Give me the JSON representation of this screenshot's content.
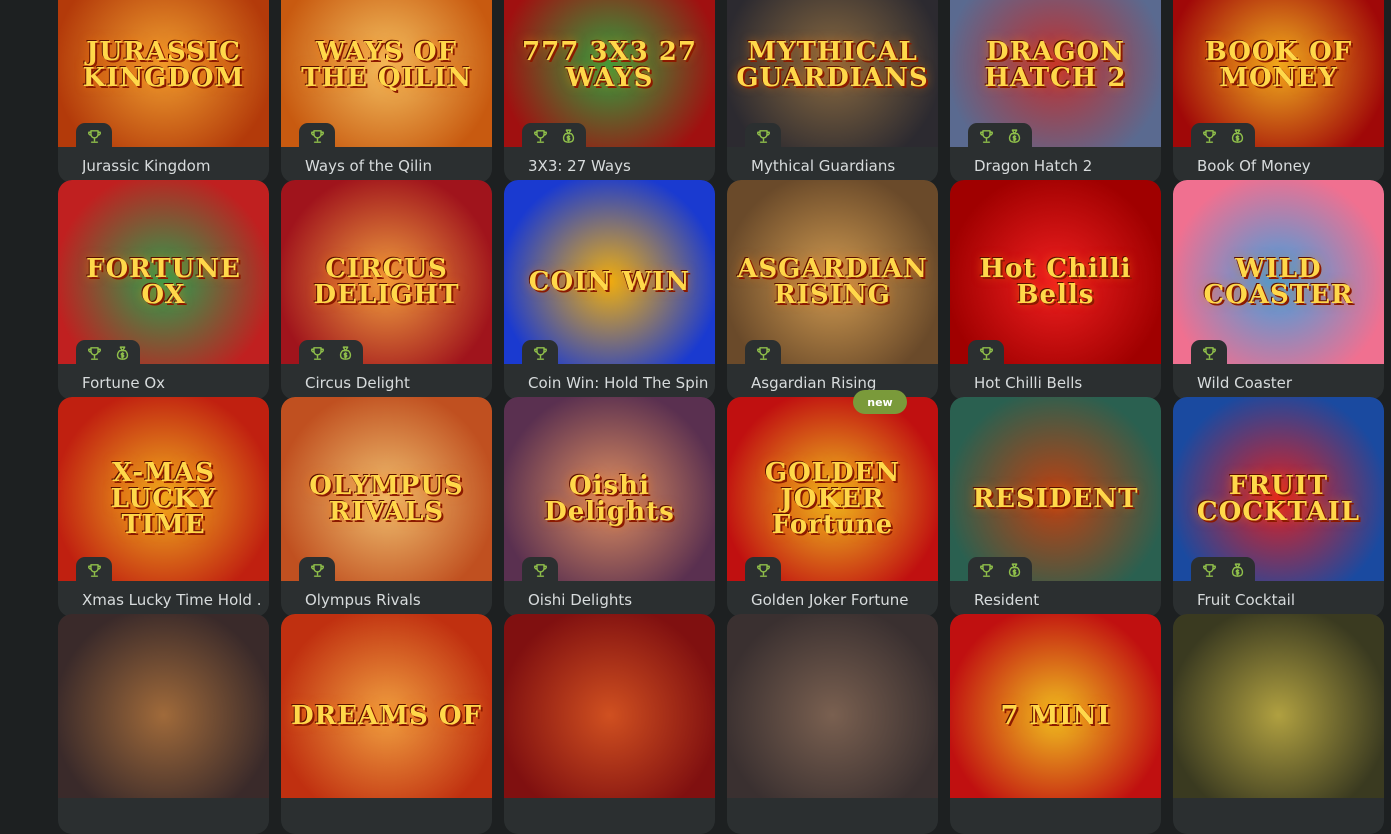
{
  "games": [
    {
      "title": "Jurassic Kingdom",
      "art_text": "JURASSIC KINGDOM",
      "badges": [
        "trophy"
      ],
      "bg": [
        "#b33a0a",
        "#f0a030"
      ]
    },
    {
      "title": "Ways of the Qilin",
      "art_text": "WAYS OF THE QILIN",
      "badges": [
        "trophy"
      ],
      "bg": [
        "#c85a10",
        "#f4c060"
      ]
    },
    {
      "title": "3X3: 27 Ways",
      "art_text": "777 3X3 27 WAYS",
      "badges": [
        "trophy",
        "money-bag"
      ],
      "bg": [
        "#a01010",
        "#30a040"
      ]
    },
    {
      "title": "Mythical Guardians",
      "art_text": "MYTHICAL GUARDIANS",
      "badges": [
        "trophy"
      ],
      "bg": [
        "#2c2a30",
        "#8a6a40"
      ]
    },
    {
      "title": "Dragon Hatch 2",
      "art_text": "DRAGON HATCH 2",
      "badges": [
        "trophy",
        "money-bag"
      ],
      "bg": [
        "#5a6a90",
        "#c03030"
      ]
    },
    {
      "title": "Book Of Money",
      "art_text": "BOOK OF MONEY",
      "badges": [
        "trophy",
        "money-bag"
      ],
      "bg": [
        "#a00808",
        "#f0b020"
      ]
    },
    {
      "title": "Fortune Ox",
      "art_text": "FORTUNE OX",
      "badges": [
        "trophy",
        "money-bag"
      ],
      "bg": [
        "#c02020",
        "#2aa050"
      ]
    },
    {
      "title": "Circus Delight",
      "art_text": "CIRCUS DELIGHT",
      "badges": [
        "trophy",
        "money-bag"
      ],
      "bg": [
        "#a0141c",
        "#f0a040"
      ]
    },
    {
      "title": "Coin Win: Hold The Spin",
      "art_text": "COIN WIN",
      "badges": [
        "trophy"
      ],
      "bg": [
        "#1a3ad0",
        "#f0b010"
      ]
    },
    {
      "title": "Asgardian Rising",
      "art_text": "ASGARDIAN RISING",
      "badges": [
        "trophy"
      ],
      "bg": [
        "#6a4a2a",
        "#d09a50"
      ]
    },
    {
      "title": "Hot Chilli Bells",
      "art_text": "Hot Chilli Bells",
      "badges": [
        "trophy"
      ],
      "bg": [
        "#a00000",
        "#f02020"
      ]
    },
    {
      "title": "Wild Coaster",
      "art_text": "WILD COASTER",
      "badges": [
        "trophy"
      ],
      "bg": [
        "#f07090",
        "#40a0e0"
      ]
    },
    {
      "title": "Xmas Lucky Time Hold ...",
      "art_text": "X-MAS LUCKY TIME",
      "badges": [
        "trophy"
      ],
      "bg": [
        "#c02010",
        "#f0b020"
      ]
    },
    {
      "title": "Olympus Rivals",
      "art_text": "OLYMPUS RIVALS",
      "badges": [
        "trophy"
      ],
      "bg": [
        "#c05020",
        "#f0c070"
      ]
    },
    {
      "title": "Oishi Delights",
      "art_text": "Oishi Delights",
      "badges": [
        "trophy"
      ],
      "bg": [
        "#5a3050",
        "#e09060"
      ]
    },
    {
      "title": "Golden Joker Fortune",
      "art_text": "GOLDEN JOKER Fortune",
      "badges": [
        "trophy"
      ],
      "bg": [
        "#c01010",
        "#f0c020"
      ],
      "new": "new"
    },
    {
      "title": "Resident",
      "art_text": "RESIDENT",
      "badges": [
        "trophy",
        "money-bag"
      ],
      "bg": [
        "#2a6050",
        "#c04010"
      ]
    },
    {
      "title": "Fruit Cocktail",
      "art_text": "FRUIT COCKTAIL",
      "badges": [
        "trophy",
        "money-bag"
      ],
      "bg": [
        "#1a4aa0",
        "#e02020"
      ]
    },
    {
      "title": "",
      "art_text": "",
      "badges": [],
      "bg": [
        "#3a2a2a",
        "#a06a3a"
      ]
    },
    {
      "title": "",
      "art_text": "DREAMS OF",
      "badges": [],
      "bg": [
        "#c03010",
        "#f0a040"
      ]
    },
    {
      "title": "",
      "art_text": "",
      "badges": [],
      "bg": [
        "#801010",
        "#d05020"
      ]
    },
    {
      "title": "",
      "art_text": "",
      "badges": [],
      "bg": [
        "#3a3030",
        "#7a6050"
      ]
    },
    {
      "title": "",
      "art_text": "7 MINI",
      "badges": [],
      "bg": [
        "#c01010",
        "#f0c020"
      ]
    },
    {
      "title": "",
      "art_text": "",
      "badges": [],
      "bg": [
        "#3a3a20",
        "#b0a040"
      ]
    }
  ],
  "colors": {
    "page_bg": "#1d2021",
    "card_bg": "#2b2f30",
    "title": "#d7dbdc",
    "icon": "#8fbf4a",
    "new_tag": "#7a9a3a"
  }
}
